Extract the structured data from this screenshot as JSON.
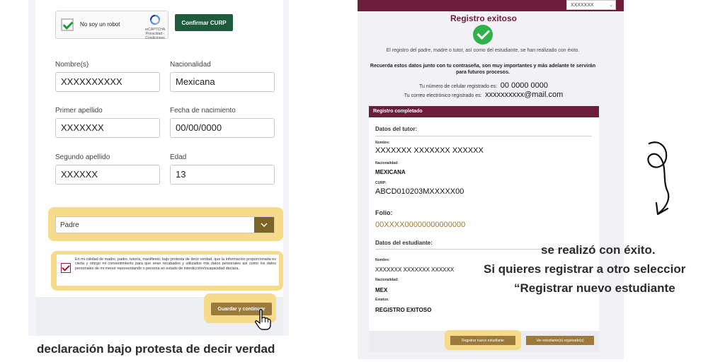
{
  "left": {
    "captcha": {
      "label": "No soy un robot",
      "brand": "reCAPTCHA",
      "links": "Privacidad - Condiciones"
    },
    "confirm_button": "Confirmar CURP",
    "fields": {
      "nombre": {
        "label": "Nombre(s)",
        "value": "XXXXXXXXXX"
      },
      "nacionalidad": {
        "label": "Nacionalidad",
        "value": "Mexicana"
      },
      "primer_apellido": {
        "label": "Primer apellido",
        "value": "XXXXXXX"
      },
      "fecha_nacimiento": {
        "label": "Fecha de nacimiento",
        "value": "00/00/0000"
      },
      "segundo_apellido": {
        "label": "Segundo apellido",
        "value": "XXXXXX"
      },
      "edad": {
        "label": "Edad",
        "value": "13"
      }
    },
    "parentesco_value": "Padre",
    "declaration_text": "En mi calidad de madre, padre, tutor/a, manifiesto, bajo protesta de decir verdad, que la información proporcionada es cierta y otorgo mi consentimiento para que sean recabados y utilizados mis datos personales así como los datos personales de mi menor representando o persona en estado de interdicción/incapacidad declara.",
    "save_button": "Guardar y continuar",
    "caption": "declaración bajo protesta de decir verdad"
  },
  "right": {
    "top_select": "XXXXXXX",
    "title": "Registro exitoso",
    "message": "El registro del padre, madre o tutor, así como del estudiante, se han realizado con éxito.",
    "bold_message": "Recuerda estos datos junto con tu contraseña, son muy importantes y más adelante te servirán para futuros procesos.",
    "phone_label": "Tu número de celular registrado es:",
    "phone_value": "00 0000 0000",
    "email_label": "Tu correo electrónico registrado es:",
    "email_value": "xxxxxxxxxx@mail.com",
    "card_title": "Registro completado",
    "tutor_section": "Datos del tutor:",
    "tutor": {
      "nombre_k": "Nombre:",
      "nombre_v": "XXXXXXX XXXXXXX XXXXXX",
      "nac_k": "Nacionalidad:",
      "nac_v": "MEXICANA",
      "curp_k": "CURP:",
      "curp_v": "ABCD010203MXXXXX00"
    },
    "folio_label": "Folio:",
    "folio_value": "00XXXX00000000000000",
    "student_section": "Datos del estudiante:",
    "student": {
      "nombre_k": "Nombre:",
      "nombre_v": "XXXXXXX XXXXXXX XXXXXX",
      "nac_k": "Nacionalidad:",
      "nac_v": "MEX",
      "estatus_k": "Estatus:",
      "estatus_v": "REGISTRO EXITOSO"
    },
    "register_button": "Registrar nuevo estudiante",
    "view_button": "Ver estudiante(s) registrado(s)"
  },
  "captions_right": {
    "line1": "se realizó con éxito.",
    "line2": "Si quieres registrar a otro seleccior",
    "line3": "“Registrar nuevo estudiante"
  },
  "colors": {
    "brand": "#6c1d3a",
    "gold": "#9b7a3c",
    "highlight": "#f6dc8a",
    "green": "#1e5b3c"
  }
}
